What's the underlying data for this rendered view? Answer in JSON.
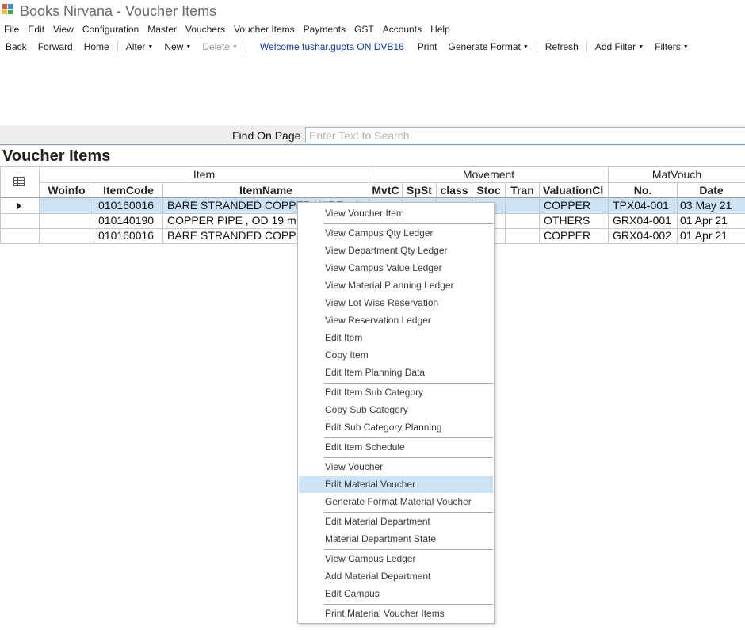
{
  "window": {
    "title": "Books Nirvana - Voucher Items"
  },
  "menu": [
    "File",
    "Edit",
    "View",
    "Configuration",
    "Master",
    "Vouchers",
    "Voucher Items",
    "Payments",
    "GST",
    "Accounts",
    "Help"
  ],
  "toolbar": {
    "back": "Back",
    "forward": "Forward",
    "home": "Home",
    "alter": "Alter",
    "new": "New",
    "delete": "Delete",
    "welcome": "Welcome tushar.gupta ON DVB16",
    "print": "Print",
    "generate_format": "Generate Format",
    "refresh": "Refresh",
    "add_filter": "Add Filter",
    "filters": "Filters"
  },
  "find": {
    "label": "Find On Page",
    "placeholder": "Enter Text to Search"
  },
  "section_title": "Voucher Items",
  "grid": {
    "groups": {
      "item": "Item",
      "movement": "Movement",
      "matvouch": "MatVouch"
    },
    "columns": {
      "woinfo": "Woinfo",
      "itemcode": "ItemCode",
      "itemname": "ItemName",
      "mvtc": "MvtC",
      "spst": "SpSt",
      "class": "class",
      "stoc": "Stoc",
      "tran": "Tran",
      "valuation": "ValuationCl",
      "no": "No.",
      "date": "Date"
    },
    "rows": [
      {
        "itemcode": "010160016",
        "itemname": "BARE STRANDED COPPER WIRE , 4",
        "valuation": "COPPER",
        "no": "TPX04-001",
        "date": "03 May 21"
      },
      {
        "itemcode": "010140190",
        "itemname": "COPPER PIPE , OD 19 m",
        "valuation": "OTHERS",
        "no": "GRX04-001",
        "date": "01 Apr 21"
      },
      {
        "itemcode": "010160016",
        "itemname": "BARE STRANDED COPP",
        "valuation": "COPPER",
        "no": "GRX04-002",
        "date": "01 Apr 21"
      }
    ]
  },
  "context_menu": {
    "items": [
      "View Voucher Item",
      "View Campus Qty Ledger",
      "View Department Qty Ledger",
      "View Campus Value Ledger",
      "View Material Planning Ledger",
      "View Lot Wise Reservation",
      "View Reservation Ledger",
      "Edit Item",
      "Copy Item",
      "Edit Item Planning Data",
      "Edit Item Sub Category",
      "Copy Sub Category",
      "Edit Sub Category Planning",
      "Edit Item Schedule",
      "View Voucher",
      "Edit Material Voucher",
      "Generate Format Material Voucher",
      "Edit Material Department",
      "Material Department State",
      "View Campus Ledger",
      "Add Material Department",
      "Edit Campus",
      "Print Material Voucher Items"
    ],
    "highlighted": "Edit Material Voucher"
  },
  "colors": {
    "accent": "#7aa2cc",
    "selection": "#cde4f7",
    "welcome_text": "#0b3aa8"
  }
}
